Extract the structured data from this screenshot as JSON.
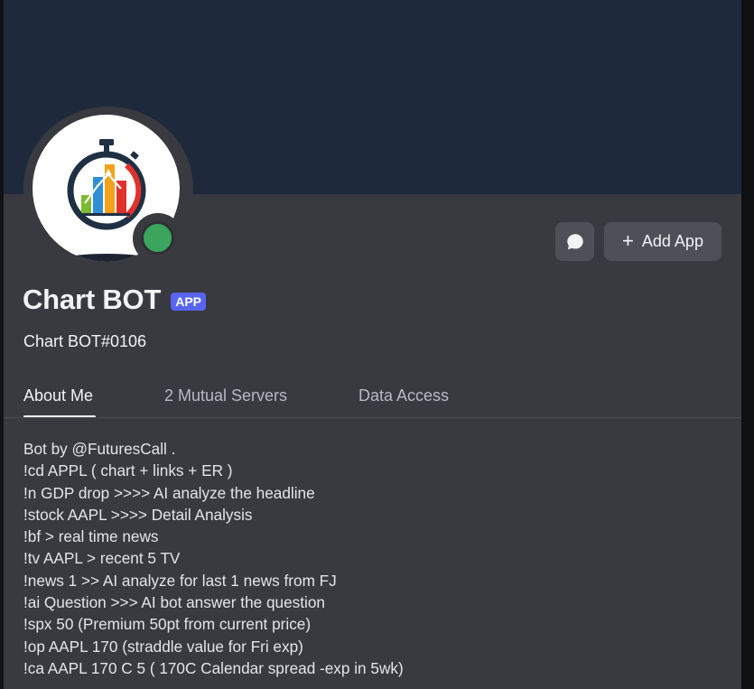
{
  "profile": {
    "display_name": "Chart BOT",
    "badge": "APP",
    "username": "Chart BOT#0106",
    "status_color": "#3ba55d",
    "avatar_icon": "stopwatch-bar-chart-icon"
  },
  "actions": {
    "message_icon": "chat-bubble-icon",
    "add_app_label": "Add App",
    "add_app_icon": "plus-icon"
  },
  "tabs": [
    {
      "label": "About Me",
      "active": true
    },
    {
      "label": "2 Mutual Servers",
      "active": false
    },
    {
      "label": "Data Access",
      "active": false
    }
  ],
  "about_me": [
    "Bot by @FuturesCall .",
    "!cd APPL ( chart + links + ER )",
    "!n GDP drop >>>> AI analyze the headline",
    "!stock AAPL >>>> Detail Analysis",
    "!bf > real time news",
    "!tv AAPL > recent 5 TV",
    "!news 1 >> AI analyze for last 1 news from FJ",
    "!ai Question >>> AI bot answer the question",
    "!spx 50 (Premium 50pt from current price)",
    "!op AAPL 170 (straddle value for Fri exp)",
    "!ca AAPL 170 C 5 ( 170C Calendar spread -exp in 5wk)"
  ],
  "colors": {
    "banner": "#1e293b",
    "panel": "#393a40",
    "accent": "#5865f2",
    "button": "#4e5058"
  }
}
